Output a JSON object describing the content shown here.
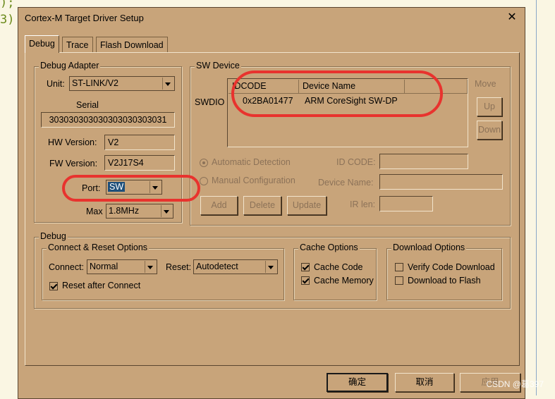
{
  "background_code": {
    "line1": ");",
    "line2": "3)"
  },
  "window": {
    "title": "Cortex-M Target Driver Setup",
    "close_glyph": "✕"
  },
  "tabs": [
    {
      "label": "Debug"
    },
    {
      "label": "Trace"
    },
    {
      "label": "Flash Download"
    }
  ],
  "debug_adapter": {
    "legend": "Debug Adapter",
    "unit_label": "Unit:",
    "unit_value": "ST-LINK/V2",
    "serial_label": "Serial",
    "serial_value": "303030303030303030303031",
    "hw_label": "HW Version:",
    "hw_value": "V2",
    "fw_label": "FW Version:",
    "fw_value": "V2J17S4",
    "port_label": "Port:",
    "port_value": "SW",
    "max_label": "Max",
    "max_value": "1.8MHz"
  },
  "sw_device": {
    "legend": "SW Device",
    "swdio_label": "SWDIO",
    "columns": [
      "IDCODE",
      "Device Name"
    ],
    "rows": [
      {
        "idcode": "0x2BA01477",
        "device_name": "ARM CoreSight SW-DP"
      }
    ],
    "move_label": "Move",
    "up_label": "Up",
    "down_label": "Down",
    "auto_detect_label": "Automatic Detection",
    "manual_config_label": "Manual Configuration",
    "id_code_label": "ID CODE:",
    "device_name_label": "Device Name:",
    "ir_len_label": "IR len:",
    "add_label": "Add",
    "delete_label": "Delete",
    "update_label": "Update"
  },
  "debug": {
    "legend": "Debug",
    "connect_reset": {
      "legend": "Connect & Reset Options",
      "connect_label": "Connect:",
      "connect_value": "Normal",
      "reset_label": "Reset:",
      "reset_value": "Autodetect",
      "reset_after_connect_label": "Reset after Connect"
    },
    "cache": {
      "legend": "Cache Options",
      "cache_code_label": "Cache Code",
      "cache_memory_label": "Cache Memory"
    },
    "download": {
      "legend": "Download Options",
      "verify_label": "Verify Code Download",
      "download_flash_label": "Download to Flash"
    }
  },
  "footer": {
    "ok_label": "确定",
    "cancel_label": "取消",
    "apply_label": "应用"
  },
  "watermark": "CSDN @葛397",
  "colors": {
    "window_bg": "#c8a47a",
    "annotation": "#e8332e",
    "selection": "#1e4f7a"
  }
}
